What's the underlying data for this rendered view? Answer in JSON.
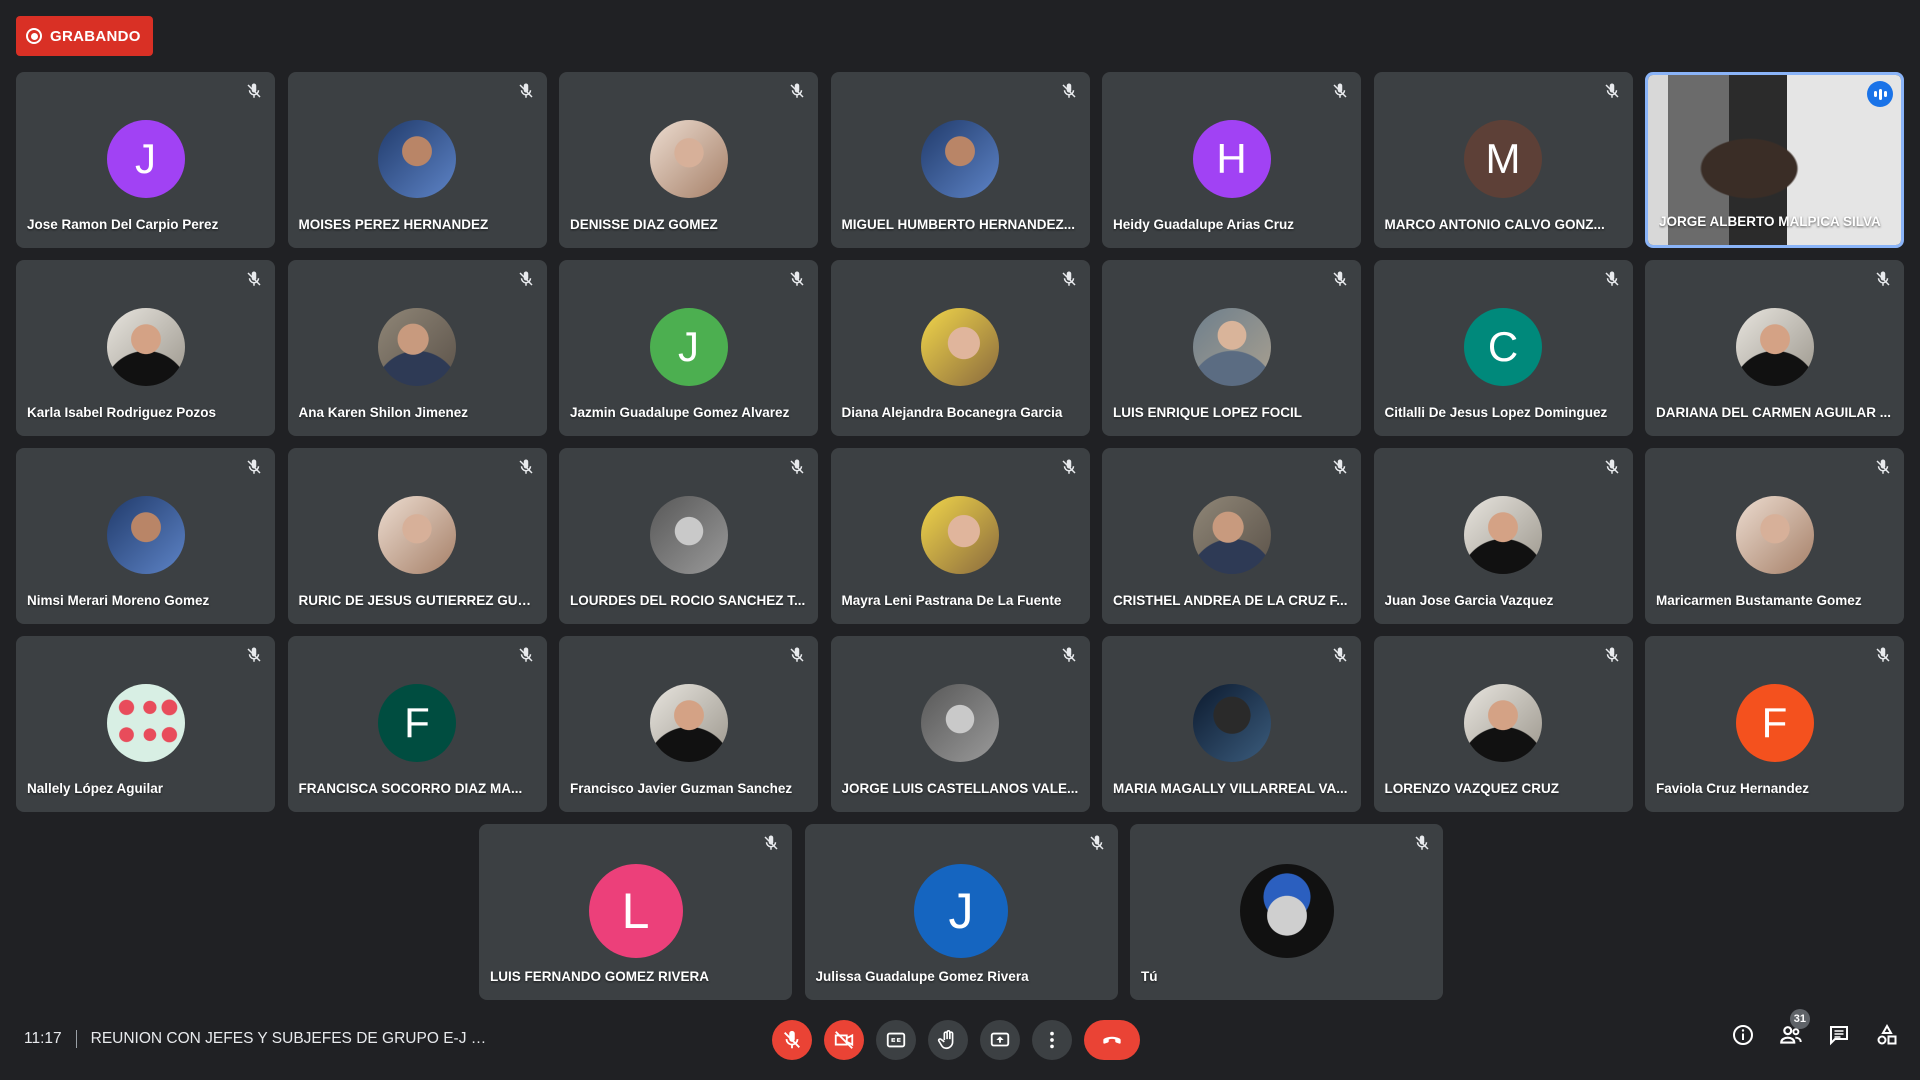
{
  "recording": {
    "label": "GRABANDO"
  },
  "participants": [
    {
      "name": "Jose Ramon Del Carpio Perez",
      "initial": "J",
      "color": "#a142f4",
      "type": "initial"
    },
    {
      "name": "MOISES PEREZ HERNANDEZ",
      "type": "photo",
      "photo": "p5"
    },
    {
      "name": "DENISSE DIAZ GOMEZ",
      "type": "photo",
      "photo": "p8"
    },
    {
      "name": "MIGUEL HUMBERTO HERNANDEZ...",
      "type": "photo",
      "photo": "p5"
    },
    {
      "name": "Heidy Guadalupe Arias Cruz",
      "initial": "H",
      "color": "#a142f4",
      "type": "initial"
    },
    {
      "name": "MARCO ANTONIO CALVO GONZ...",
      "initial": "M",
      "color": "#5d4037",
      "type": "initial"
    },
    {
      "name": "JORGE ALBERTO MALPICA SILVA",
      "type": "video",
      "active": true
    },
    {
      "name": "Karla Isabel Rodriguez Pozos",
      "type": "photo",
      "photo": "p4"
    },
    {
      "name": "Ana Karen Shilon Jimenez",
      "type": "photo",
      "photo": "p2"
    },
    {
      "name": "Jazmin Guadalupe Gomez Alvarez",
      "initial": "J",
      "color": "#4caf50",
      "type": "initial"
    },
    {
      "name": "Diana Alejandra Bocanegra Garcia",
      "type": "photo",
      "photo": "p3"
    },
    {
      "name": "LUIS ENRIQUE LOPEZ FOCIL",
      "type": "photo",
      "photo": "p1"
    },
    {
      "name": "Citlalli De Jesus Lopez Dominguez",
      "initial": "C",
      "color": "#00897b",
      "type": "initial"
    },
    {
      "name": "DARIANA DEL CARMEN AGUILAR ...",
      "type": "photo",
      "photo": "p4"
    },
    {
      "name": "Nimsi Merari Moreno Gomez",
      "type": "photo",
      "photo": "p5"
    },
    {
      "name": "RURIC DE JESUS GUTIERREZ GUTI...",
      "type": "photo",
      "photo": "p8"
    },
    {
      "name": "LOURDES DEL ROCIO SANCHEZ T...",
      "type": "photo",
      "photo": "p7"
    },
    {
      "name": "Mayra Leni Pastrana De La Fuente",
      "type": "photo",
      "photo": "p3"
    },
    {
      "name": "CRISTHEL ANDREA DE LA CRUZ F...",
      "type": "photo",
      "photo": "p2"
    },
    {
      "name": "Juan Jose Garcia Vazquez",
      "type": "photo",
      "photo": "p4"
    },
    {
      "name": "Maricarmen Bustamante Gomez",
      "type": "photo",
      "photo": "p8"
    },
    {
      "name": "Nallely López Aguilar",
      "type": "photo",
      "photo": "melon"
    },
    {
      "name": "FRANCISCA SOCORRO DIAZ MA...",
      "initial": "F",
      "color": "#004d40",
      "type": "initial"
    },
    {
      "name": "Francisco Javier Guzman Sanchez",
      "type": "photo",
      "photo": "p4"
    },
    {
      "name": "JORGE LUIS CASTELLANOS VALE...",
      "type": "photo",
      "photo": "p7"
    },
    {
      "name": "MARIA MAGALLY VILLARREAL VA...",
      "type": "photo",
      "photo": "p6"
    },
    {
      "name": "LORENZO VAZQUEZ CRUZ",
      "type": "photo",
      "photo": "p4"
    }
  ],
  "participants_last_col": {
    "name": "Faviola Cruz Hernandez",
    "initial": "F",
    "color": "#f4511e",
    "type": "initial"
  },
  "bottom_participants": [
    {
      "name": "LUIS FERNANDO GOMEZ RIVERA",
      "initial": "L",
      "color": "#ec407a",
      "type": "initial"
    },
    {
      "name": "Julissa Guadalupe Gomez Rivera",
      "initial": "J",
      "color": "#1565c0",
      "type": "initial"
    },
    {
      "name": "Tú",
      "type": "photo",
      "photo": "me"
    }
  ],
  "footer": {
    "time": "11:17",
    "meeting_title": "REUNION CON JEFES Y SUBJEFES DE GRUPO E-J 2...",
    "participant_count": "31"
  },
  "colors": {
    "background": "#202124",
    "tile": "#3c4043",
    "danger": "#ea4335",
    "accent": "#1a73e8",
    "active_border": "#8ab4f8"
  },
  "icons": {
    "mic_off": "mic-off-icon",
    "camera_off": "camera-off-icon",
    "captions": "captions-icon",
    "raise_hand": "hand-icon",
    "present": "present-icon",
    "more": "more-vert-icon",
    "hangup": "phone-hangup-icon",
    "info": "info-icon",
    "people": "people-icon",
    "chat": "chat-icon",
    "activities": "activities-icon"
  }
}
